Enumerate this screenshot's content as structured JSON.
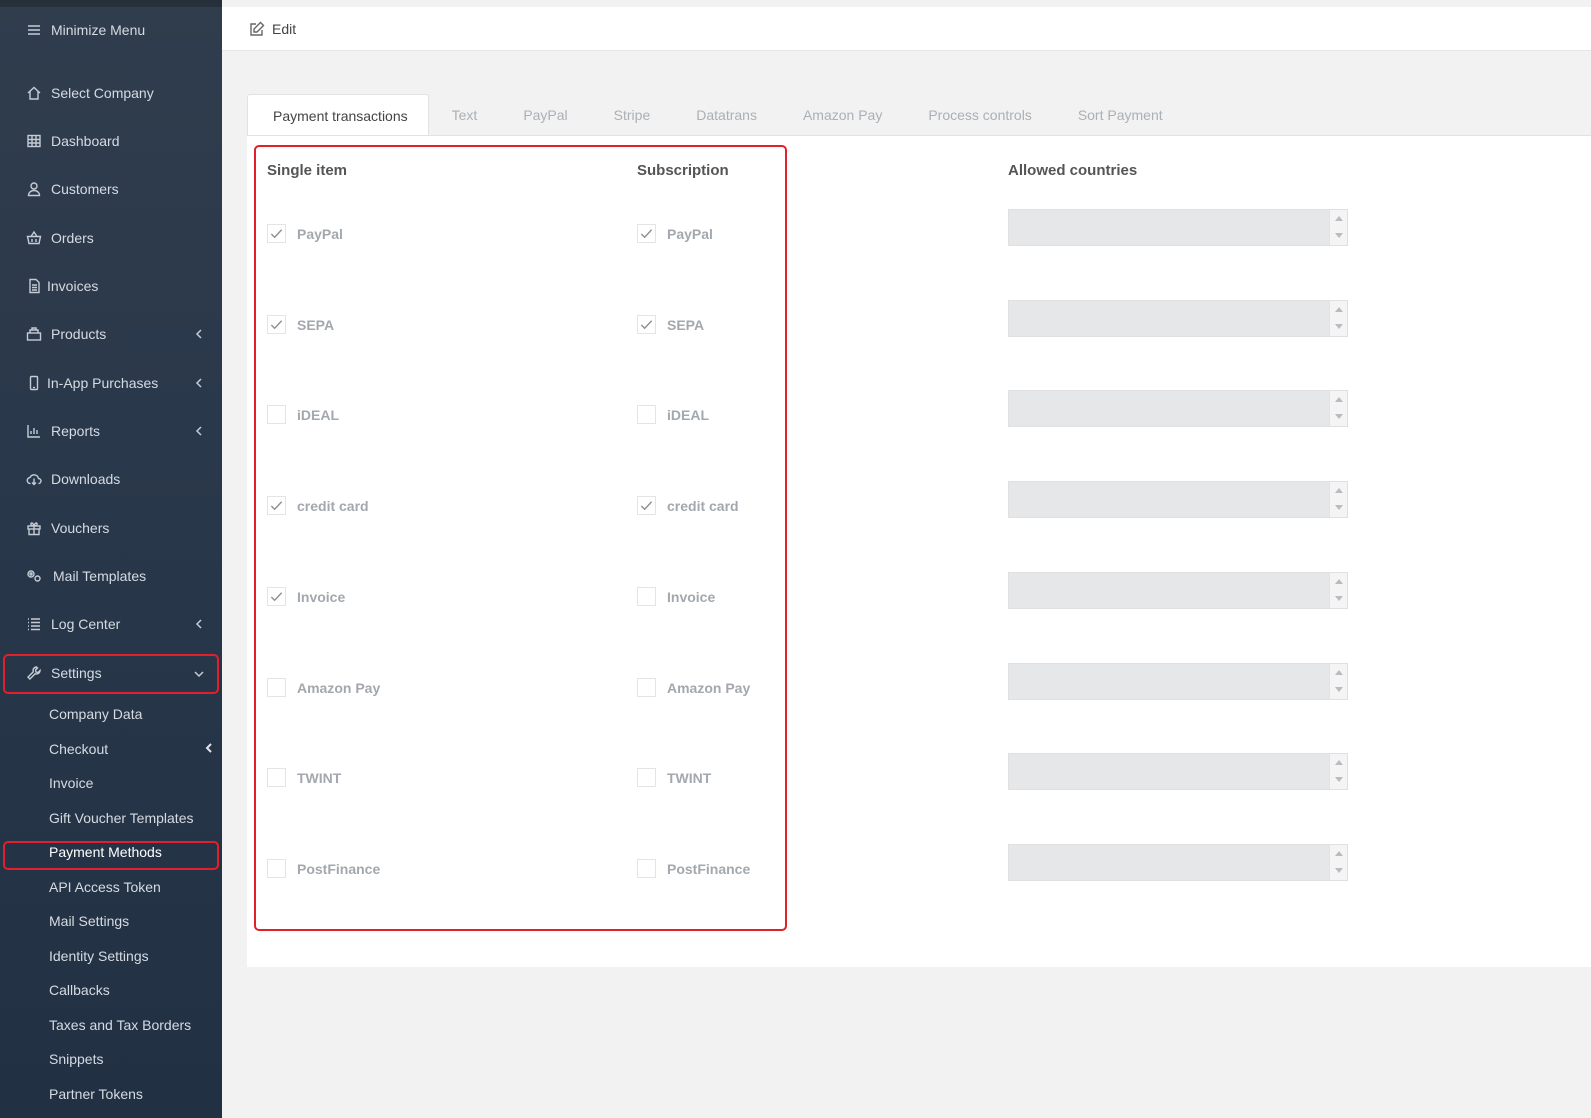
{
  "sidebar": {
    "minimize": "Minimize Menu",
    "items": [
      {
        "label": "Select Company"
      },
      {
        "label": "Dashboard"
      },
      {
        "label": "Customers"
      },
      {
        "label": "Orders"
      },
      {
        "label": "Invoices"
      },
      {
        "label": "Products"
      },
      {
        "label": "In-App Purchases"
      },
      {
        "label": "Reports"
      },
      {
        "label": "Downloads"
      },
      {
        "label": "Vouchers"
      },
      {
        "label": "Mail Templates"
      },
      {
        "label": "Log Center"
      },
      {
        "label": "Settings"
      }
    ],
    "settings_sub": [
      {
        "label": "Company Data"
      },
      {
        "label": "Checkout"
      },
      {
        "label": "Invoice"
      },
      {
        "label": "Gift Voucher Templates"
      },
      {
        "label": "Payment Methods"
      },
      {
        "label": "API Access Token"
      },
      {
        "label": "Mail Settings"
      },
      {
        "label": "Identity Settings"
      },
      {
        "label": "Callbacks"
      },
      {
        "label": "Taxes and Tax Borders"
      },
      {
        "label": "Snippets"
      },
      {
        "label": "Partner Tokens"
      }
    ]
  },
  "topbar": {
    "edit_label": "Edit"
  },
  "tabs": [
    {
      "label": "Payment transactions"
    },
    {
      "label": "Text"
    },
    {
      "label": "PayPal"
    },
    {
      "label": "Stripe"
    },
    {
      "label": "Datatrans"
    },
    {
      "label": "Amazon Pay"
    },
    {
      "label": "Process controls"
    },
    {
      "label": "Sort Payment"
    }
  ],
  "columns": {
    "single": "Single item",
    "subscription": "Subscription",
    "countries": "Allowed countries"
  },
  "methods": [
    {
      "label": "PayPal",
      "single": true,
      "subscription": true
    },
    {
      "label": "SEPA",
      "single": true,
      "subscription": true
    },
    {
      "label": "iDEAL",
      "single": false,
      "subscription": false
    },
    {
      "label": "credit card",
      "single": true,
      "subscription": true
    },
    {
      "label": "Invoice",
      "single": true,
      "subscription": false
    },
    {
      "label": "Amazon Pay",
      "single": false,
      "subscription": false
    },
    {
      "label": "TWINT",
      "single": false,
      "subscription": false
    },
    {
      "label": "PostFinance",
      "single": false,
      "subscription": false
    }
  ],
  "colors": {
    "highlight": "#e0202a",
    "sidebar_bg": "#2b394b"
  }
}
